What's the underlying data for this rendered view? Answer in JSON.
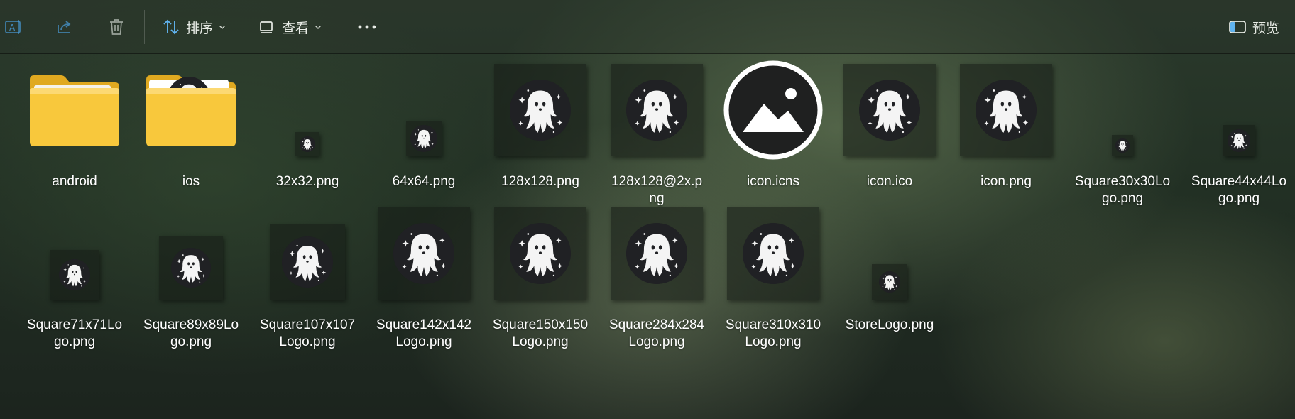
{
  "toolbar": {
    "rename_icon": "rename-icon",
    "share_icon": "share-icon",
    "delete_icon": "trash-icon",
    "sort_label": "排序",
    "view_label": "查看",
    "more_icon": "more-dots-icon",
    "preview_label": "预览"
  },
  "colors": {
    "folder_yellow": "#f8c83c",
    "ghost_bg": "#202124",
    "ghost_white": "#f4f4f4",
    "accent_blue": "#60b4f0"
  },
  "files": [
    {
      "name": "android",
      "label_lines": [
        "android"
      ],
      "kind": "folder"
    },
    {
      "name": "ios",
      "label_lines": [
        "ios"
      ],
      "kind": "folder-preview"
    },
    {
      "name": "32x32.png",
      "label_lines": [
        "32x32.png"
      ],
      "kind": "ghost"
    },
    {
      "name": "64x64.png",
      "label_lines": [
        "64x64.png"
      ],
      "kind": "ghost"
    },
    {
      "name": "128x128.png",
      "label_lines": [
        "128x128.png"
      ],
      "kind": "ghost"
    },
    {
      "name": "128x128@2x.png",
      "label_lines": [
        "128x128@2x.p",
        "ng"
      ],
      "kind": "ghost"
    },
    {
      "name": "icon.icns",
      "label_lines": [
        "icon.icns"
      ],
      "kind": "image-placeholder"
    },
    {
      "name": "icon.ico",
      "label_lines": [
        "icon.ico"
      ],
      "kind": "ghost"
    },
    {
      "name": "icon.png",
      "label_lines": [
        "icon.png"
      ],
      "kind": "ghost"
    },
    {
      "name": "Square30x30Logo.png",
      "label_lines": [
        "Square30x30Lo",
        "go.png"
      ],
      "kind": "ghost"
    },
    {
      "name": "Square44x44Logo.png",
      "label_lines": [
        "Square44x44Lo",
        "go.png"
      ],
      "kind": "ghost"
    },
    {
      "name": "Square71x71Logo.png",
      "label_lines": [
        "Square71x71Lo",
        "go.png"
      ],
      "kind": "ghost"
    },
    {
      "name": "Square89x89Logo.png",
      "label_lines": [
        "Square89x89Lo",
        "go.png"
      ],
      "kind": "ghost"
    },
    {
      "name": "Square107x107Logo.png",
      "label_lines": [
        "Square107x107",
        "Logo.png"
      ],
      "kind": "ghost"
    },
    {
      "name": "Square142x142Logo.png",
      "label_lines": [
        "Square142x142",
        "Logo.png"
      ],
      "kind": "ghost"
    },
    {
      "name": "Square150x150Logo.png",
      "label_lines": [
        "Square150x150",
        "Logo.png"
      ],
      "kind": "ghost"
    },
    {
      "name": "Square284x284Logo.png",
      "label_lines": [
        "Square284x284",
        "Logo.png"
      ],
      "kind": "ghost"
    },
    {
      "name": "Square310x310Logo.png",
      "label_lines": [
        "Square310x310",
        "Logo.png"
      ],
      "kind": "ghost"
    },
    {
      "name": "StoreLogo.png",
      "label_lines": [
        "StoreLogo.png"
      ],
      "kind": "ghost"
    }
  ]
}
